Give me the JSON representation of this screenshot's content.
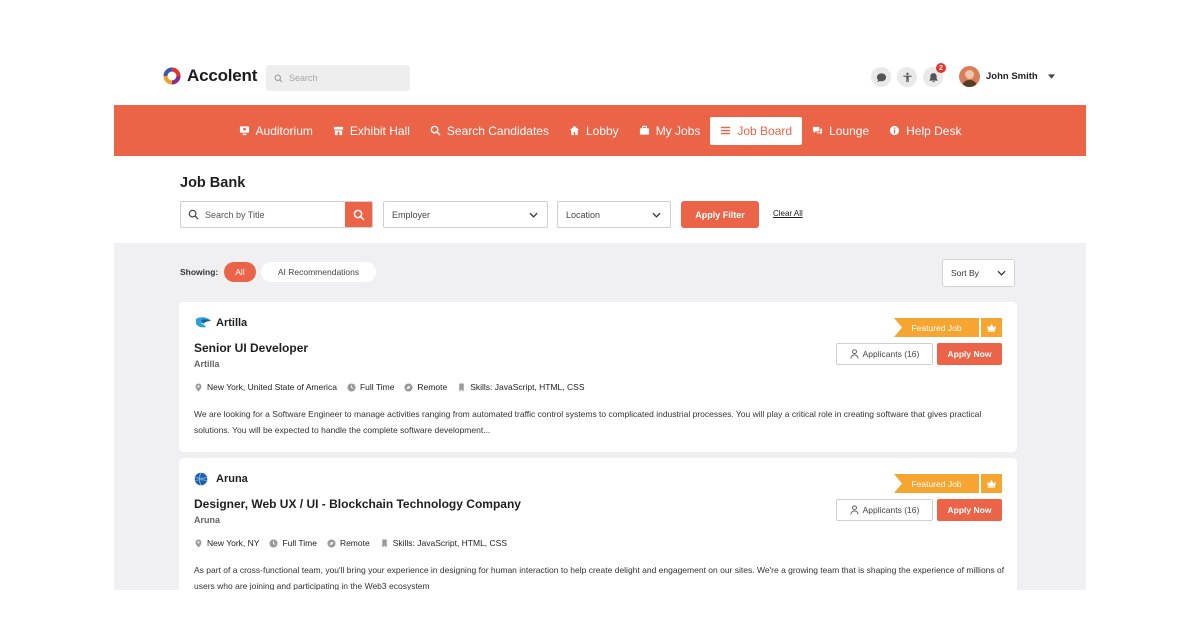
{
  "brand": {
    "name": "Accolent"
  },
  "top_search": {
    "placeholder": "Search"
  },
  "notifications": {
    "count": "2"
  },
  "user": {
    "name": "John Smith"
  },
  "nav": {
    "items": [
      {
        "label": "Auditorium",
        "icon": "auditorium-icon"
      },
      {
        "label": "Exhibit Hall",
        "icon": "exhibit-hall-icon"
      },
      {
        "label": "Search Candidates",
        "icon": "search-icon"
      },
      {
        "label": "Lobby",
        "icon": "home-icon"
      },
      {
        "label": "My Jobs",
        "icon": "briefcase-icon"
      },
      {
        "label": "Job Board",
        "icon": "list-icon",
        "active": true
      },
      {
        "label": "Lounge",
        "icon": "chat-icon"
      },
      {
        "label": "Help Desk",
        "icon": "info-icon"
      }
    ]
  },
  "page": {
    "title": "Job Bank"
  },
  "filters": {
    "search_placeholder": "Search by Title",
    "employer": "Employer",
    "location": "Location",
    "apply_label": "Apply Filter",
    "clear_label": "Clear All"
  },
  "showing": {
    "label": "Showing:",
    "all": "All",
    "ai": "AI Recommendations"
  },
  "sort": {
    "label": "Sort By"
  },
  "colors": {
    "accent": "#ec6448",
    "featured": "#f6a531",
    "background": "#f0f0f2"
  },
  "jobs": [
    {
      "company": "Artilla",
      "title": "Senior UI Developer",
      "company_sub": "Artilla",
      "location": "New York, United State of America",
      "type": "Full Time",
      "mode": "Remote",
      "skills": "Skills: JavaScript, HTML, CSS",
      "featured": "Featured Job",
      "applicants": "Applicants (16)",
      "apply": "Apply Now",
      "description": "We are looking for a Software Engineer to manage activities ranging from automated traffic control systems to complicated industrial processes. You will play a critical role in creating software that gives practical solutions. You will be expected to handle the complete software development..."
    },
    {
      "company": "Aruna",
      "title": "Designer, Web UX / UI - Blockchain Technology Company",
      "company_sub": "Aruna",
      "location": "New York, NY",
      "type": "Full Time",
      "mode": "Remote",
      "skills": "Skills: JavaScript, HTML, CSS",
      "featured": "Featured Job",
      "applicants": "Applicants (16)",
      "apply": "Apply Now",
      "description": "As part of a cross-functional team, you'll bring your experience in designing for human interaction to help create delight and engagement on our sites. We're a growing team that is shaping the experience of millions of users who are joining and participating in the Web3 ecosystem"
    }
  ]
}
